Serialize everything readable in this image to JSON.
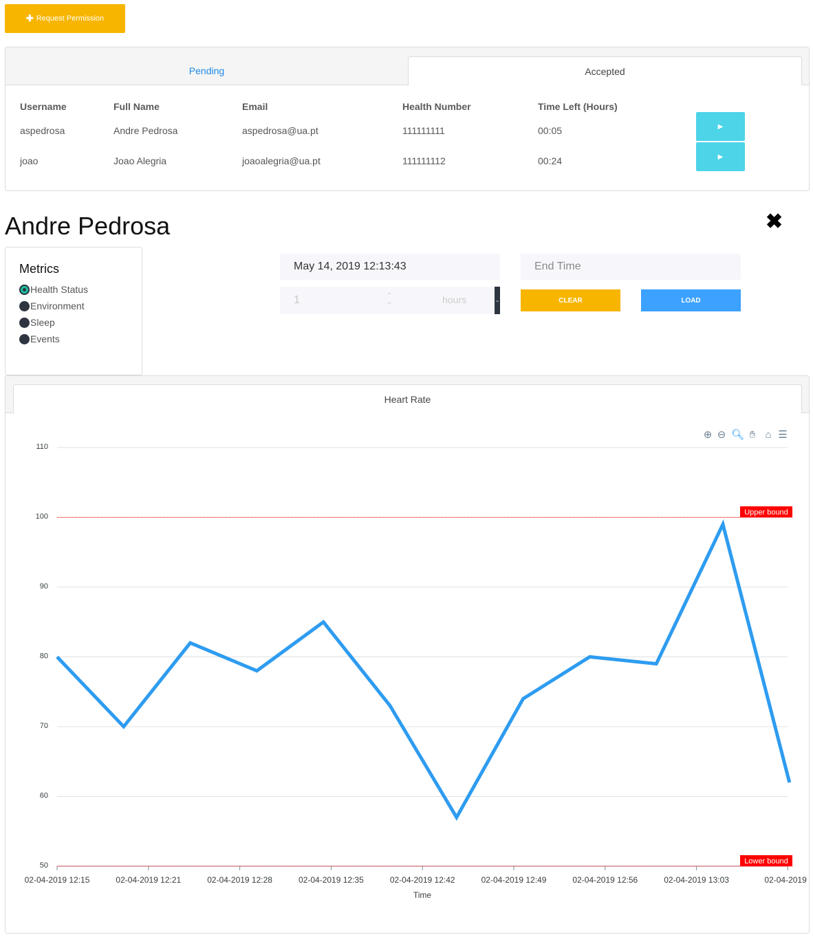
{
  "toolbar": {
    "request_label": "Request Permission",
    "request_icon": "plus-icon"
  },
  "permissions": {
    "tabs": [
      {
        "label": "Pending",
        "active": false
      },
      {
        "label": "Accepted",
        "active": true
      }
    ],
    "columns": [
      "Username",
      "Full Name",
      "Email",
      "Health Number",
      "Time Left (Hours)"
    ],
    "rows": [
      {
        "username": "aspedrosa",
        "full_name": "Andre Pedrosa",
        "email": "aspedrosa@ua.pt",
        "health_number": "111111111",
        "time_left": "00:05"
      },
      {
        "username": "joao",
        "full_name": "Joao Alegria",
        "email": "joaoalegria@ua.pt",
        "health_number": "111111112",
        "time_left": "00:24"
      }
    ],
    "row_action_icon": "play-icon"
  },
  "patient": {
    "name": "Andre Pedrosa",
    "close_icon": "close-icon"
  },
  "metrics": {
    "title": "Metrics",
    "options": [
      {
        "label": "Health Status",
        "checked": true
      },
      {
        "label": "Environment",
        "checked": false
      },
      {
        "label": "Sleep",
        "checked": false
      },
      {
        "label": "Events",
        "checked": false
      }
    ]
  },
  "filters": {
    "start_time": "May 14, 2019 12:13:43",
    "end_time_placeholder": "End Time",
    "hours_value": "1",
    "hours_unit": "hours",
    "clear_label": "CLEAR",
    "load_label": "LOAD"
  },
  "chart_tab": {
    "label": "Heart Rate"
  },
  "chart_toolbar_icons": [
    "zoom-in-icon",
    "zoom-out-icon",
    "zoom-select-icon",
    "pan-icon",
    "home-icon",
    "menu-icon"
  ],
  "colors": {
    "accent_yellow": "#f7b500",
    "accent_blue": "#3ca1ff",
    "play_cyan": "#4dd4e8",
    "line": "#2e9cf0",
    "bound": "#ff0000"
  },
  "chart_data": {
    "type": "line",
    "title": "",
    "xlabel": "Time",
    "ylabel": "",
    "ylim": [
      50,
      110
    ],
    "yticks": [
      50,
      60,
      70,
      80,
      90,
      100,
      110
    ],
    "x_tick_labels": [
      "02-04-2019 12:15",
      "02-04-2019 12:21",
      "02-04-2019 12:28",
      "02-04-2019 12:35",
      "02-04-2019 12:42",
      "02-04-2019 12:49",
      "02-04-2019 12:56",
      "02-04-2019 13:03",
      "02-04-2019"
    ],
    "values": [
      80,
      70,
      82,
      78,
      85,
      73,
      57,
      74,
      80,
      79,
      99,
      62
    ],
    "annotations": [
      {
        "label": "Upper bound",
        "y": 100
      },
      {
        "label": "Lower bound",
        "y": 50
      }
    ],
    "grid": true
  }
}
